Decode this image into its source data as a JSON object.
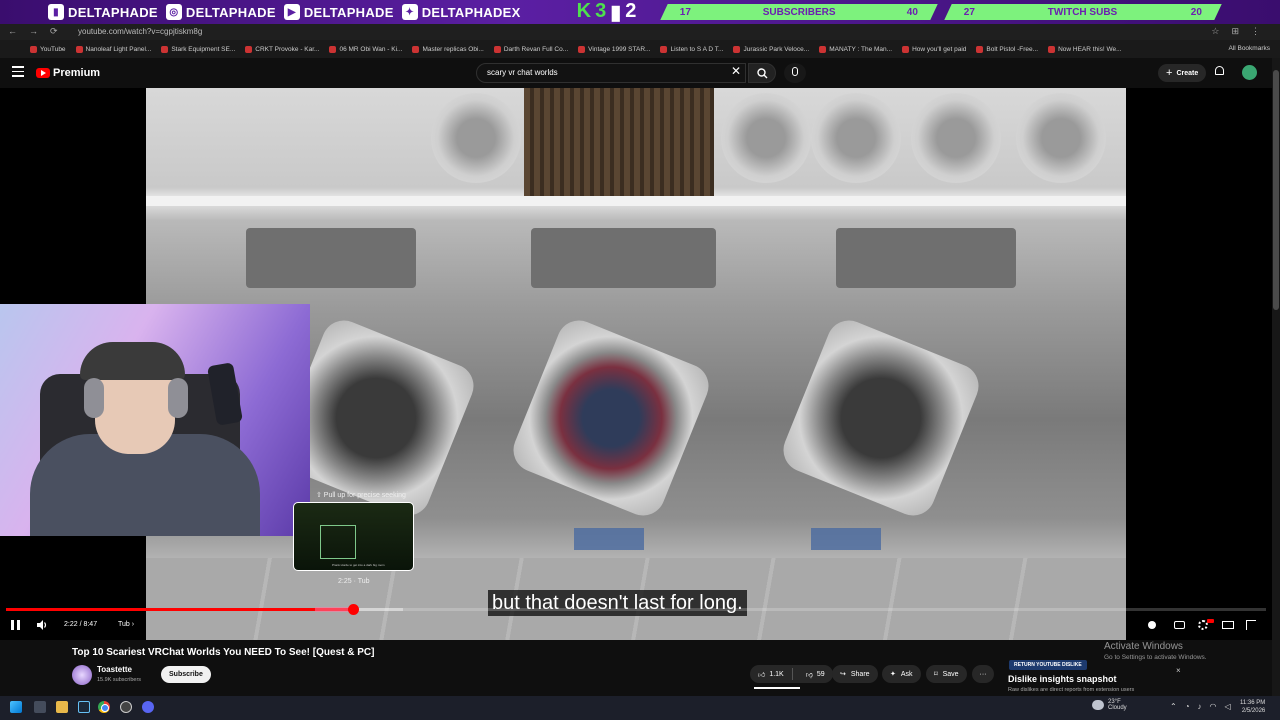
{
  "overlay": {
    "socials": [
      {
        "name": "DELTAPHADE",
        "icon": "twitch-icon"
      },
      {
        "name": "DELTAPHADE",
        "icon": "instagram-icon"
      },
      {
        "name": "DELTAPHADE",
        "icon": "youtube-icon"
      },
      {
        "name": "DELTAPHADEX",
        "icon": "twitter-icon"
      }
    ],
    "k3_left": "K",
    "k3_mid": "3",
    "k3_right": "2",
    "goals": [
      {
        "current": "17",
        "label": "SUBSCRIBERS",
        "target": "40"
      },
      {
        "current": "27",
        "label": "TWITCH SUBS",
        "target": "20"
      }
    ]
  },
  "browser": {
    "url": "youtube.com/watch?v=cgpjtiskm8g",
    "bookmarks": [
      "YouTube",
      "Nanoleaf Light Panel...",
      "Stark Equipment SE...",
      "CRKT Provoke - Kar...",
      "06 MR Obi Wan - Ki...",
      "Master replicas Obi...",
      "Darth Revan Full Co...",
      "Vintage 1999 STAR...",
      "Listen to S A D T...",
      "Jurassic Park Veloce...",
      "MANATY : The Man...",
      "How you'll get paid",
      "Bolt Pistol -Free...",
      "Now HEAR this! We..."
    ],
    "all_bookmarks": "All Bookmarks"
  },
  "masthead": {
    "logo": "Premium",
    "search_value": "scary vr chat worlds",
    "create_label": "Create"
  },
  "player": {
    "seek_hint": "⇧ Pull up for precise seeking",
    "preview_time": "2:25 · Tub",
    "preview_tiny": "Prank Horde to get into a dark big room",
    "caption": "but that doesn't last for long.",
    "time": "2:22 / 8:47",
    "chapter": "Tub ›",
    "progress_played": 0.275,
    "progress_buffer": 0.315,
    "progress_hover_start": 0.245,
    "progress_hover_end": 0.275
  },
  "video": {
    "title": "Top 10 Scariest VRChat Worlds You NEED To See! [Quest & PC]",
    "channel": "Toastette",
    "subs": "15.9K subscribers",
    "subscribe": "Subscribe",
    "likes": "1.1K",
    "dislikes": "59",
    "share": "Share",
    "ask": "Ask",
    "save": "Save",
    "more": "···"
  },
  "ryd": {
    "badge": "RETURN YOUTUBE DISLIKE",
    "title": "Dislike insights snapshot",
    "sub": "Raw dislikes are direct reports from extension users",
    "close": "×"
  },
  "activate": {
    "title": "Activate Windows",
    "sub": "Go to Settings to activate Windows."
  },
  "taskbar": {
    "temp": "23°F",
    "condition": "Cloudy",
    "time": "11:36 PM",
    "date": "2/5/2026"
  },
  "colors": {
    "overlay_purple": "#5b1fa3",
    "goal_green": "#7df27d",
    "yt_red": "#ff0000"
  }
}
